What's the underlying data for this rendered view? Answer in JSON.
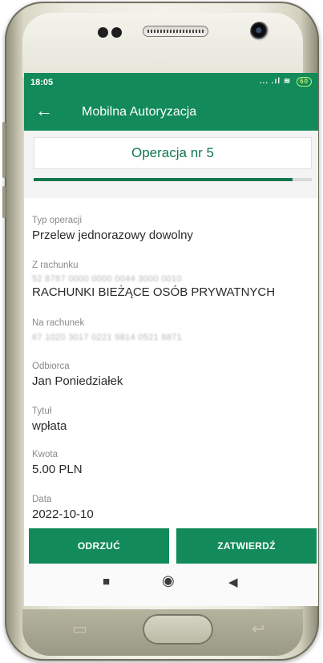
{
  "status_bar": {
    "time": "18:05",
    "signal": "... .ıl",
    "battery": "60"
  },
  "app_bar": {
    "back_icon": "arrow-left-icon",
    "title": "Mobilna Autoryzacja"
  },
  "operation": {
    "title": "Operacja nr 5",
    "progress": 0.93
  },
  "details": [
    {
      "label": "Typ operacji",
      "value": "Przelew jednorazowy dowolny"
    },
    {
      "label": "Z rachunku",
      "sub": "52 8787 0000 0000 0044 3000 0010",
      "value": "RACHUNKI BIEŻĄCE OSÓB PRYWATNYCH"
    },
    {
      "label": "Na rachunek",
      "sub": "67 1020 3017 0221 9814 0521 6871"
    },
    {
      "label": "Odbiorca",
      "value": "Jan Poniedziałek"
    },
    {
      "label": "Tytuł",
      "value": "wpłata"
    },
    {
      "label": "Kwota",
      "value": "5.00 PLN"
    },
    {
      "label": "Data",
      "value": "2022-10-10"
    }
  ],
  "buttons": {
    "reject": "ODRZUĆ",
    "confirm": "ZATWIERDŹ"
  },
  "colors": {
    "primary": "#128a5a",
    "accent_text": "#12774d"
  }
}
